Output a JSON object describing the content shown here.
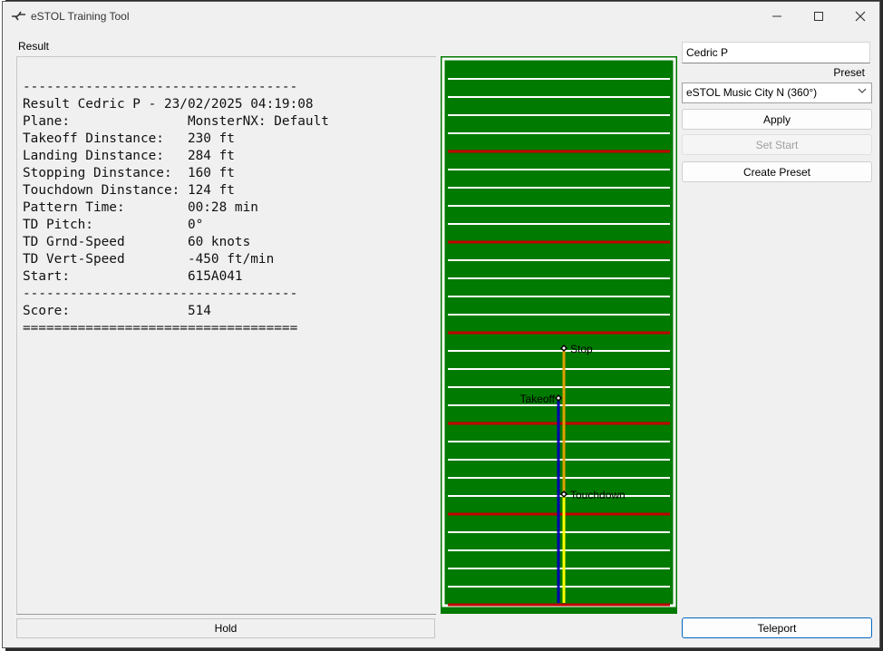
{
  "window": {
    "title": "eSTOL Training Tool"
  },
  "result": {
    "label": "Result",
    "text": "-----------------------------------\nResult Cedric P - 23/02/2025 04:19:08\nPlane:               MonsterNX: Default\nTakeoff Dinstance:   230 ft\nLanding Dinstance:   284 ft\nStopping Dinstance:  160 ft\nTouchdown Dinstance: 124 ft\nPattern Time:        00:28 min\nTD Pitch:            0°\nTD Grnd-Speed        60 knots\nTD Vert-Speed        -450 ft/min\nStart:               615A041\n-----------------------------------\nScore:               514\n==================================="
  },
  "field": {
    "colors": {
      "grass": "#007a00",
      "line": "#ffffff",
      "marker": "#c00000",
      "takeoff": "#0000b0",
      "stop": "#e0a000",
      "touchdown": "#ffff00"
    },
    "labels": {
      "stop": "Stop",
      "takeoff": "Takeoff",
      "touchdown": "Touchdown"
    }
  },
  "controls": {
    "name_value": "Cedric P",
    "preset_label": "Preset",
    "preset_value": "eSTOL Music City N (360°)",
    "apply": "Apply",
    "set_start": "Set Start",
    "create_preset": "Create Preset",
    "teleport": "Teleport",
    "hold": "Hold"
  }
}
